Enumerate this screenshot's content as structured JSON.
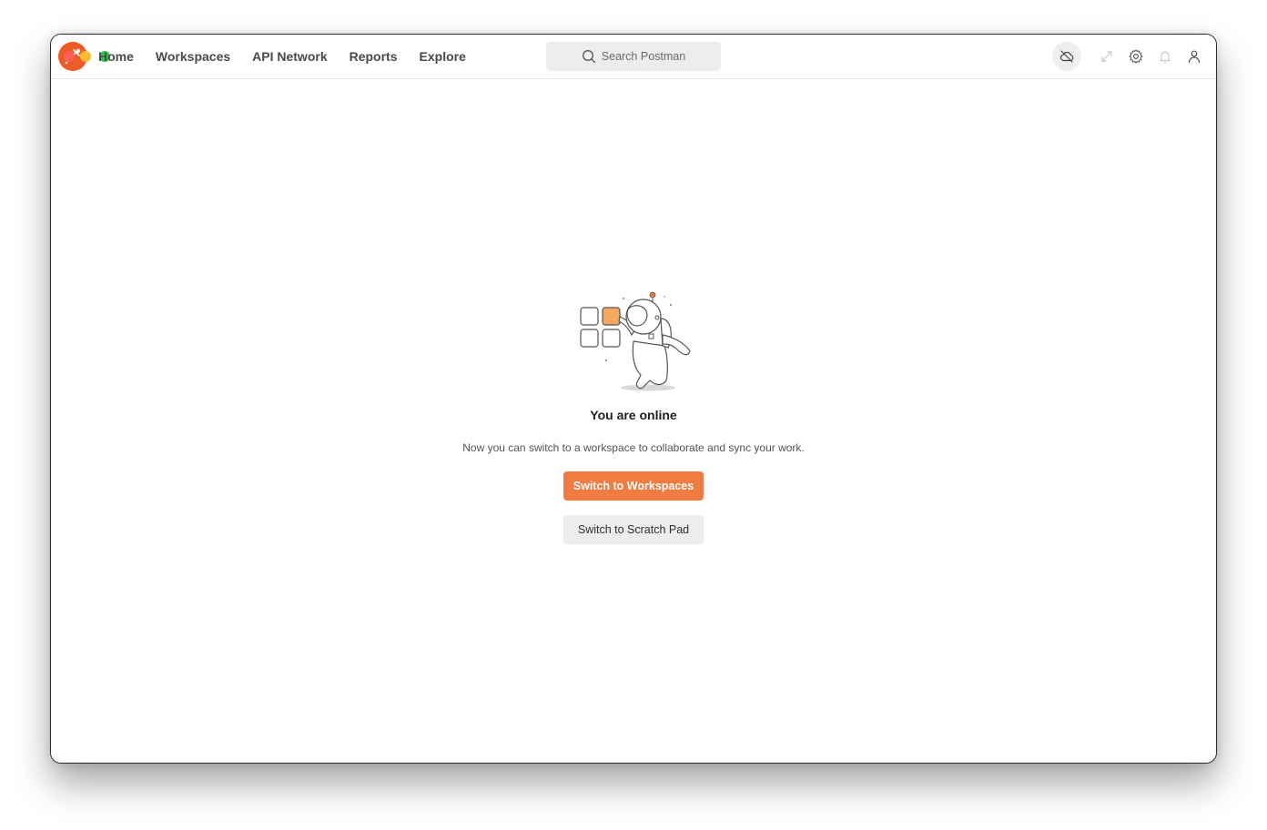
{
  "app": {
    "name": "Postman"
  },
  "nav": {
    "items": [
      {
        "label": "Home"
      },
      {
        "label": "Workspaces"
      },
      {
        "label": "API Network"
      },
      {
        "label": "Reports"
      },
      {
        "label": "Explore"
      }
    ]
  },
  "search": {
    "placeholder": "Search Postman"
  },
  "toolbar_icons": [
    "cloud-off-icon",
    "capture-requests-icon",
    "gear-icon",
    "bell-icon",
    "user-icon"
  ],
  "status": {
    "title": "You are online",
    "description": "Now you can switch to a workspace to collaborate and sync your work."
  },
  "actions": {
    "switch_workspaces": "Switch to Workspaces",
    "switch_scratch_pad": "Switch to Scratch Pad"
  },
  "colors": {
    "accent": "#f07c42",
    "brand": "#ef5b25"
  }
}
